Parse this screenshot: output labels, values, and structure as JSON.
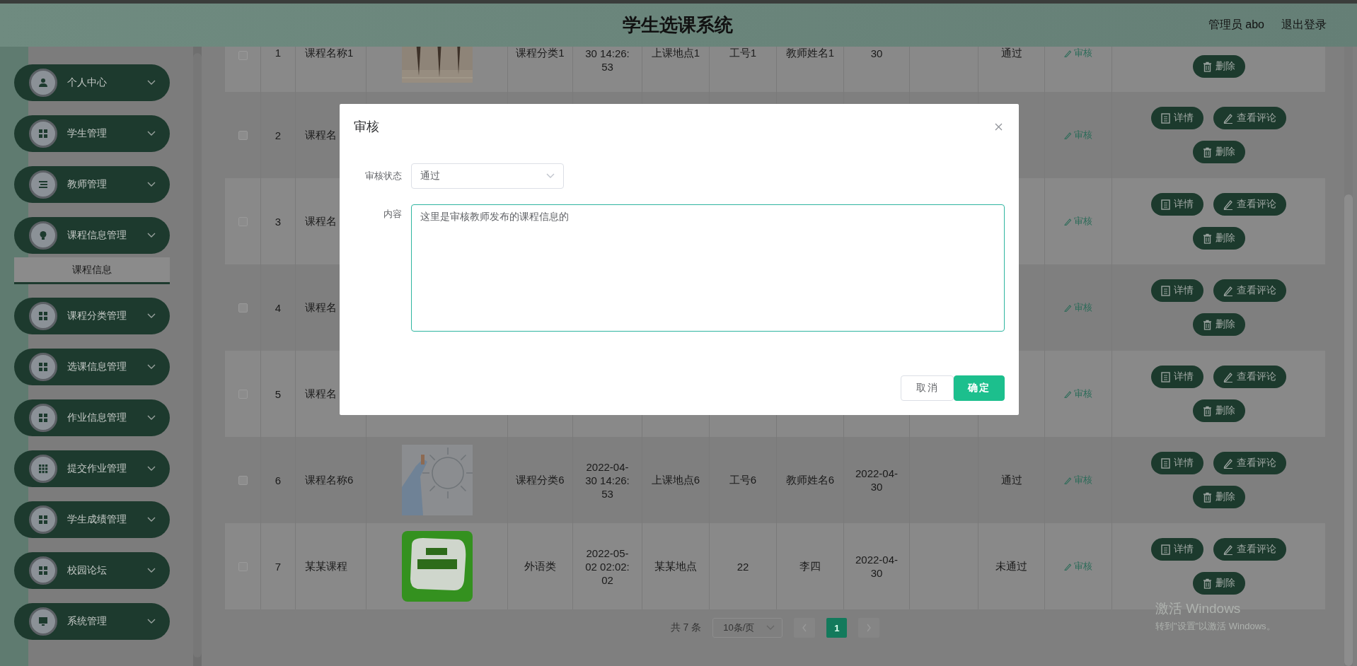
{
  "header": {
    "title": "学生选课系统",
    "user": "管理员 abo",
    "logout": "退出登录"
  },
  "sidebar": {
    "items": [
      {
        "label": "个人中心"
      },
      {
        "label": "学生管理"
      },
      {
        "label": "教师管理"
      },
      {
        "label": "课程信息管理",
        "children": [
          {
            "label": "课程信息",
            "selected": true
          }
        ]
      },
      {
        "label": "课程分类管理"
      },
      {
        "label": "选课信息管理"
      },
      {
        "label": "作业信息管理"
      },
      {
        "label": "提交作业管理"
      },
      {
        "label": "学生成绩管理"
      },
      {
        "label": "校园论坛"
      },
      {
        "label": "系统管理"
      }
    ]
  },
  "table": {
    "rows": [
      {
        "checked": false,
        "index": "1",
        "name": "课程名称1",
        "image": {
          "kind": "picture"
        },
        "category": "课程分类1",
        "time": "30 14:26:53",
        "place": "上课地点1",
        "staff_no": "工号1",
        "teacher": "教师姓名1",
        "date": "30",
        "status": "通过",
        "audit": "审核",
        "actions": [
          {
            "kind": "delete",
            "label": "删除"
          }
        ]
      },
      {
        "checked": false,
        "index": "2",
        "name": "课程名",
        "audit": "审核",
        "actions": [
          {
            "kind": "detail",
            "label": "详情"
          },
          {
            "kind": "comment",
            "label": "查看评论"
          },
          {
            "kind": "delete",
            "label": "删除"
          }
        ]
      },
      {
        "checked": false,
        "index": "3",
        "name": "课程名",
        "audit": "审核",
        "actions": [
          {
            "kind": "detail",
            "label": "详情"
          },
          {
            "kind": "comment",
            "label": "查看评论"
          },
          {
            "kind": "delete",
            "label": "删除"
          }
        ]
      },
      {
        "checked": false,
        "index": "4",
        "name": "课程名",
        "audit": "审核",
        "actions": [
          {
            "kind": "detail",
            "label": "详情"
          },
          {
            "kind": "comment",
            "label": "查看评论"
          },
          {
            "kind": "delete",
            "label": "删除"
          }
        ]
      },
      {
        "checked": false,
        "index": "5",
        "name": "课程名",
        "audit": "审核",
        "actions": [
          {
            "kind": "detail",
            "label": "详情"
          },
          {
            "kind": "comment",
            "label": "查看评论"
          },
          {
            "kind": "delete",
            "label": "删除"
          }
        ]
      },
      {
        "checked": false,
        "index": "6",
        "name": "课程名称6",
        "image": {
          "kind": "picture"
        },
        "category": "课程分类6",
        "time": "2022-04-30 14:26:53",
        "place": "上课地点6",
        "staff_no": "工号6",
        "teacher": "教师姓名6",
        "date": "2022-04-30",
        "status": "通过",
        "audit": "审核",
        "actions": [
          {
            "kind": "detail",
            "label": "详情"
          },
          {
            "kind": "comment",
            "label": "查看评论"
          },
          {
            "kind": "delete",
            "label": "删除"
          }
        ]
      },
      {
        "checked": false,
        "index": "7",
        "name": "某某课程",
        "image": {
          "kind": "picture"
        },
        "category": "外语类",
        "time": "2022-05-02 02:02:02",
        "place": "某某地点",
        "staff_no": "22",
        "teacher": "李四",
        "date": "2022-04-30",
        "status": "未通过",
        "audit": "审核",
        "actions": [
          {
            "kind": "detail",
            "label": "详情"
          },
          {
            "kind": "comment",
            "label": "查看评论"
          },
          {
            "kind": "delete",
            "label": "删除"
          }
        ]
      }
    ]
  },
  "pagination": {
    "total": "共 7 条",
    "page_size": "10条/页",
    "pages": [
      {
        "label": "1",
        "selected": true
      }
    ]
  },
  "dialog": {
    "title": "审核",
    "fields": [
      {
        "kind": "select",
        "label": "审核状态",
        "value": "通过"
      },
      {
        "kind": "textarea",
        "label": "内容",
        "value": "这里是审核教师发布的课程信息的"
      }
    ],
    "buttons": [
      {
        "kind": "default",
        "label": "取消"
      },
      {
        "kind": "primary",
        "label": "确定"
      }
    ]
  },
  "os_notice": {
    "title": "激活 Windows",
    "text": "转到\"设置\"以激活 Windows。"
  }
}
